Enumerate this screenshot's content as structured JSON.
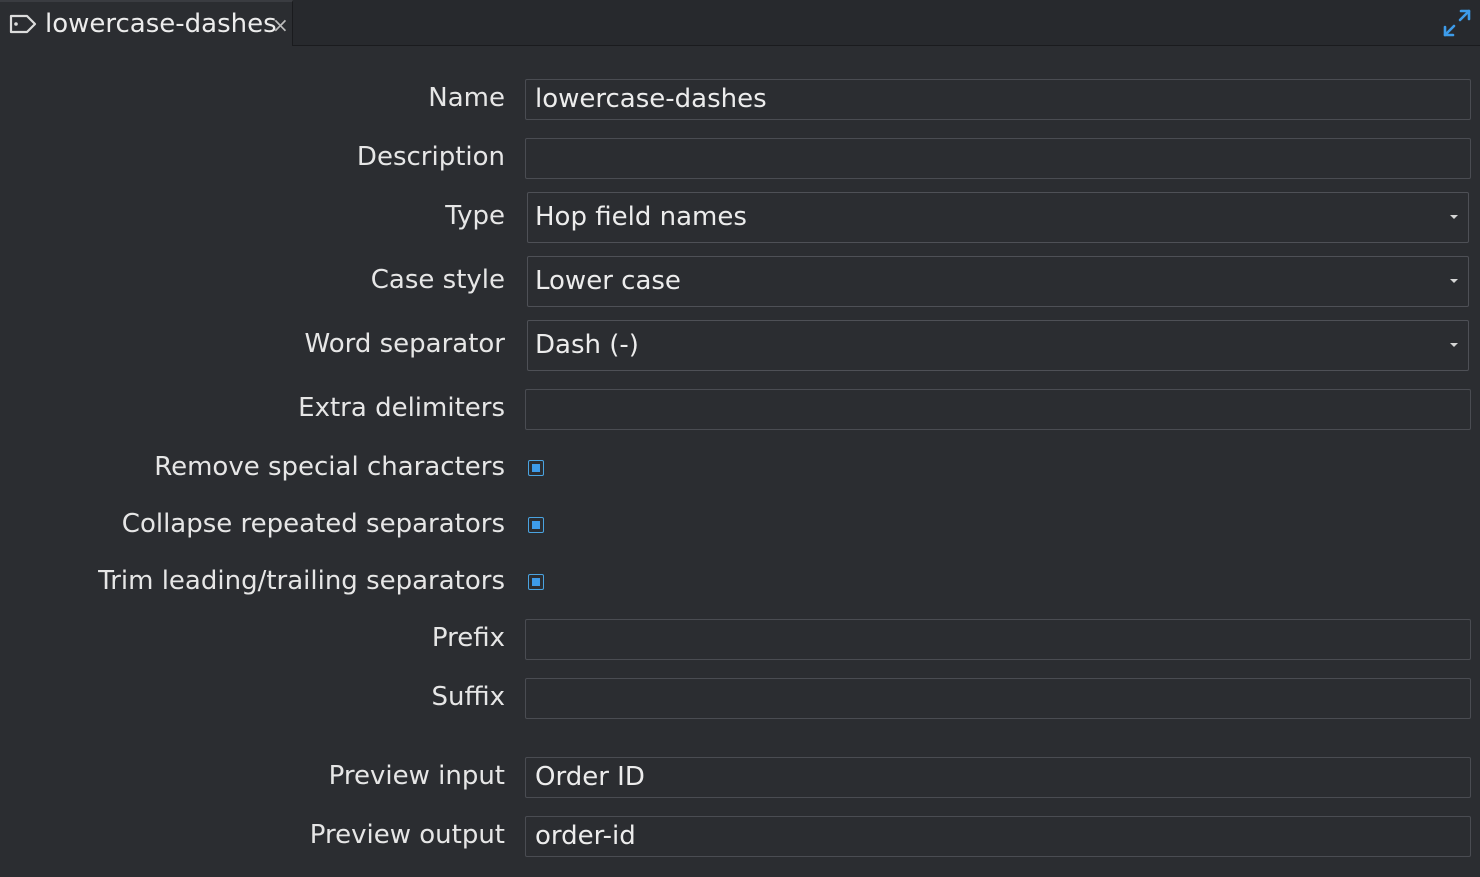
{
  "tab": {
    "title": "lowercase-dashes",
    "close_glyph": "×",
    "icon": "tag-icon"
  },
  "toolbar": {
    "maximize_icon": "maximize-icon"
  },
  "form": {
    "name": {
      "label": "Name",
      "value": "lowercase-dashes"
    },
    "description": {
      "label": "Description",
      "value": ""
    },
    "type": {
      "label": "Type",
      "value": "Hop field names"
    },
    "case_style": {
      "label": "Case style",
      "value": "Lower case"
    },
    "word_separator": {
      "label": "Word separator",
      "value": "Dash (-)"
    },
    "extra_delimiters": {
      "label": "Extra delimiters",
      "value": ""
    },
    "remove_special": {
      "label": "Remove special characters",
      "checked": true
    },
    "collapse_repeated": {
      "label": "Collapse repeated separators",
      "checked": true
    },
    "trim_separators": {
      "label": "Trim leading/trailing separators",
      "checked": true
    },
    "prefix": {
      "label": "Prefix",
      "value": ""
    },
    "suffix": {
      "label": "Suffix",
      "value": ""
    },
    "preview_input": {
      "label": "Preview input",
      "value": "Order ID"
    },
    "preview_output": {
      "label": "Preview output",
      "value": "order-id"
    }
  },
  "colors": {
    "background": "#2b2d31",
    "checkbox_accent": "#3d9be9",
    "text": "#e6e6e6"
  }
}
